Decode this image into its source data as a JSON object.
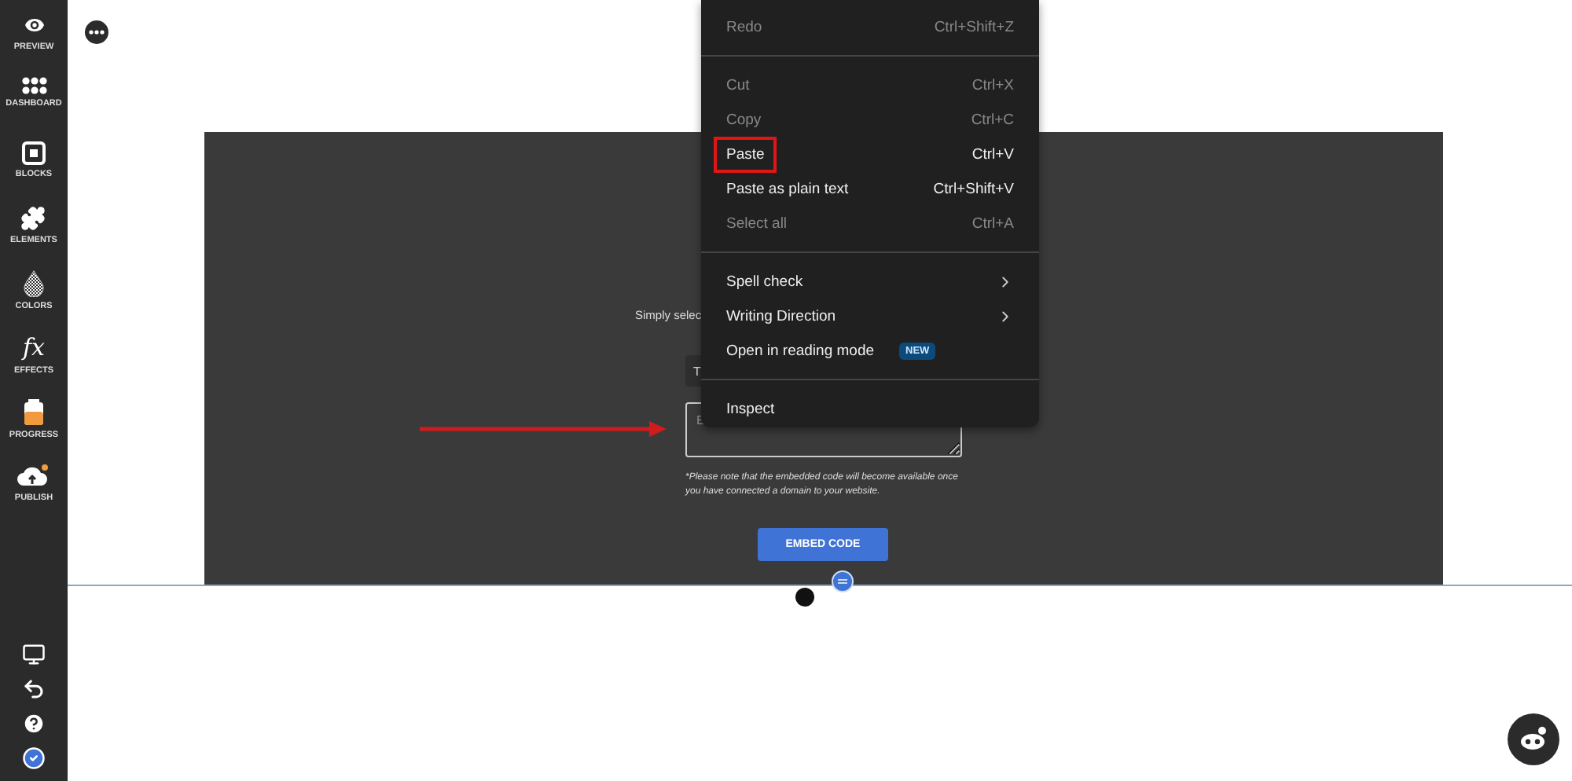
{
  "sidebar": {
    "items": [
      {
        "label": "PREVIEW",
        "kind": "eye"
      },
      {
        "label": "DASHBOARD",
        "kind": "dots"
      },
      {
        "label": "BLOCKS",
        "kind": "square"
      },
      {
        "label": "ELEMENTS",
        "kind": "puzzle"
      },
      {
        "label": "COLORS",
        "kind": "drop"
      },
      {
        "label": "EFFECTS",
        "kind": "text",
        "glyph": "fx"
      },
      {
        "label": "PROGRESS",
        "kind": "jar"
      },
      {
        "label": "PUBLISH",
        "kind": "cloud"
      }
    ],
    "bottom_tools": [
      {
        "kind": "monitor"
      },
      {
        "kind": "undo"
      },
      {
        "kind": "help"
      },
      {
        "kind": "check"
      }
    ]
  },
  "section": {
    "intro": "Simply selec",
    "select_value": "T",
    "textarea_placeholder": "E",
    "note": "*Please note that the embedded code will become available once you have connected a domain to your website.",
    "button": "EMBED CODE"
  },
  "context_menu": {
    "groups": [
      [
        {
          "label": "Redo",
          "shortcut": "Ctrl+Shift+Z",
          "disabled": true,
          "submenu": false,
          "highlighted": false
        }
      ],
      [
        {
          "label": "Cut",
          "shortcut": "Ctrl+X",
          "disabled": true,
          "submenu": false,
          "highlighted": false
        },
        {
          "label": "Copy",
          "shortcut": "Ctrl+C",
          "disabled": true,
          "submenu": false,
          "highlighted": false
        },
        {
          "label": "Paste",
          "shortcut": "Ctrl+V",
          "disabled": false,
          "submenu": false,
          "highlighted": true
        },
        {
          "label": "Paste as plain text",
          "shortcut": "Ctrl+Shift+V",
          "disabled": false,
          "submenu": false,
          "highlighted": false
        },
        {
          "label": "Select all",
          "shortcut": "Ctrl+A",
          "disabled": true,
          "submenu": false,
          "highlighted": false
        }
      ],
      [
        {
          "label": "Spell check",
          "disabled": false,
          "submenu": true,
          "highlighted": false
        },
        {
          "label": "Writing Direction",
          "disabled": false,
          "submenu": true,
          "highlighted": false
        },
        {
          "label": "Open in reading mode",
          "badge": "NEW",
          "disabled": false,
          "submenu": false,
          "highlighted": false
        }
      ],
      [
        {
          "label": "Inspect",
          "disabled": false,
          "submenu": false,
          "highlighted": false
        }
      ]
    ]
  }
}
